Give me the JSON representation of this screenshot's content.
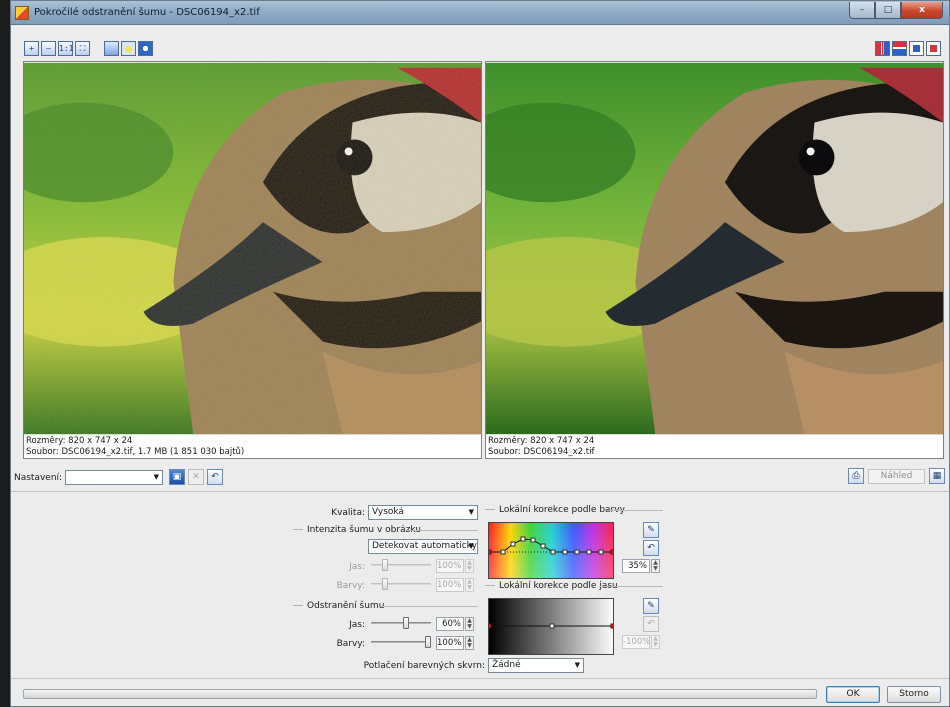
{
  "window": {
    "title": "Pokročilé odstranění šumu - DSC06194_x2.tif",
    "minimize": "–",
    "maximize": "□",
    "close": "x"
  },
  "toolbar": {
    "zoom_in": "+",
    "zoom_out": "–",
    "one_to_one": "1:1",
    "fit": "⛶"
  },
  "left_pane": {
    "dims": "Rozměry: 820 x 747 x 24",
    "file": "Soubor: DSC06194_x2.tif, 1.7 MB (1 851 030 bajtů)"
  },
  "right_pane": {
    "dims": "Rozměry: 820 x 747 x 24",
    "file": "Soubor: DSC06194_x2.tif"
  },
  "preset": {
    "label": "Nastavení:",
    "value": "",
    "preview_label": "Náhled"
  },
  "quality": {
    "label": "Kvalita:",
    "value": "Vysoká"
  },
  "noise_intensity": {
    "title": "Intenzita šumu v obrázku",
    "mode": "Detekovat automaticky",
    "brightness_label": "Jas:",
    "brightness_value": "100%",
    "brightness_level": 0.2,
    "colors_label": "Barvy:",
    "colors_value": "100%",
    "colors_level": 0.2
  },
  "noise_removal": {
    "title": "Odstranění šumu",
    "brightness_label": "Jas:",
    "brightness_value": "60%",
    "brightness_level": 0.6,
    "colors_label": "Barvy:",
    "colors_value": "100%",
    "colors_level": 1.0
  },
  "color_correction": {
    "title": "Lokální korekce podle barvy",
    "value": "35%"
  },
  "brightness_correction": {
    "title": "Lokální korekce podle jasu",
    "value": "-100%"
  },
  "color_spots": {
    "label": "Potlačení barevných skvrn:",
    "value": "Žádné"
  },
  "buttons": {
    "ok": "OK",
    "cancel": "Storno"
  },
  "colors": {
    "titlebar": "#8eaac6",
    "window_bg": "#ececec",
    "accent": "#3c7fb1"
  }
}
